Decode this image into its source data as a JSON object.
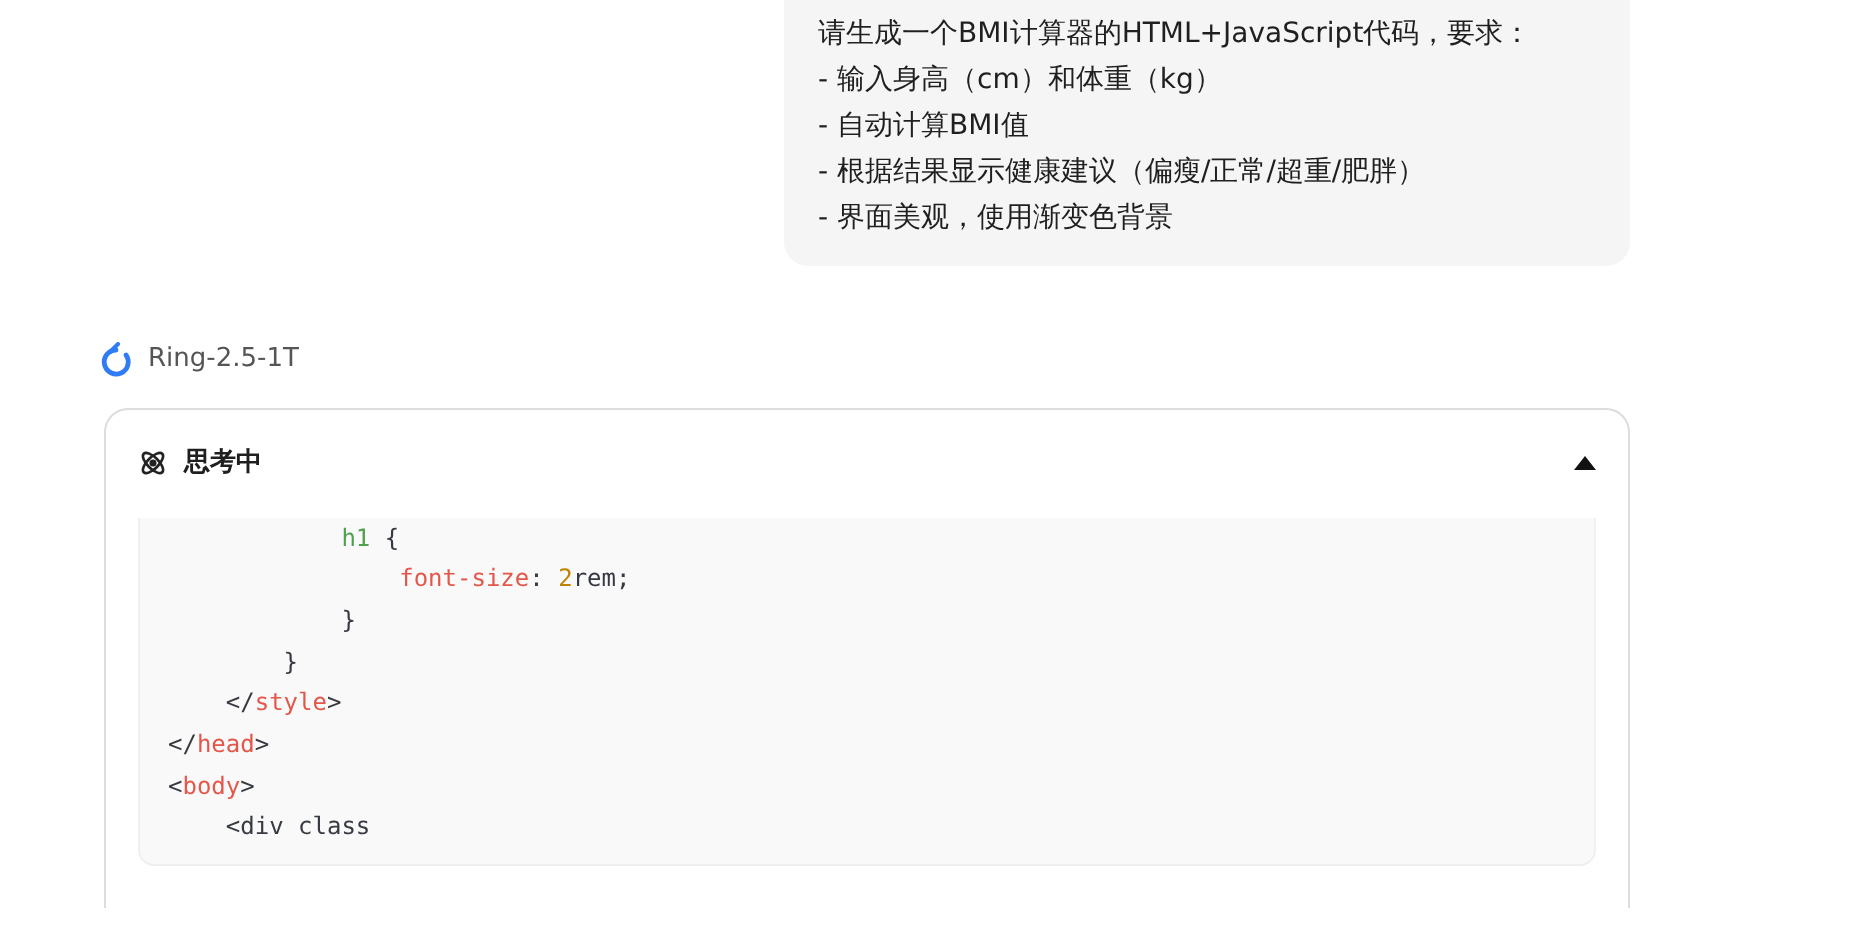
{
  "user_message": {
    "lines": [
      "请生成一个BMI计算器的HTML+JavaScript代码，要求：",
      "- 输入身高（cm）和体重（kg）",
      "- 自动计算BMI值",
      "- 根据结果显示健康建议（偏瘦/正常/超重/肥胖）",
      "- 界面美观，使用渐变色背景"
    ]
  },
  "model": {
    "name": "Ring-2.5-1T"
  },
  "thinking": {
    "label": "思考中",
    "expanded": true,
    "code_lines": [
      [
        {
          "kind": "selector",
          "text": "            h1"
        },
        {
          "kind": "plain",
          "text": " {"
        }
      ],
      [
        {
          "kind": "property",
          "text": "                font-size"
        },
        {
          "kind": "plain",
          "text": ": "
        },
        {
          "kind": "number",
          "text": "2"
        },
        {
          "kind": "plain",
          "text": "rem;"
        }
      ],
      [
        {
          "kind": "plain",
          "text": "            }"
        }
      ],
      [
        {
          "kind": "plain",
          "text": "        }"
        }
      ],
      [
        {
          "kind": "plain",
          "text": "    </"
        },
        {
          "kind": "tag",
          "text": "style"
        },
        {
          "kind": "plain",
          "text": ">"
        }
      ],
      [
        {
          "kind": "plain",
          "text": "</"
        },
        {
          "kind": "tag",
          "text": "head"
        },
        {
          "kind": "plain",
          "text": ">"
        }
      ],
      [
        {
          "kind": "plain",
          "text": "<"
        },
        {
          "kind": "tag",
          "text": "body"
        },
        {
          "kind": "plain",
          "text": ">"
        }
      ],
      [
        {
          "kind": "plain",
          "text": "    <div class"
        }
      ]
    ]
  }
}
